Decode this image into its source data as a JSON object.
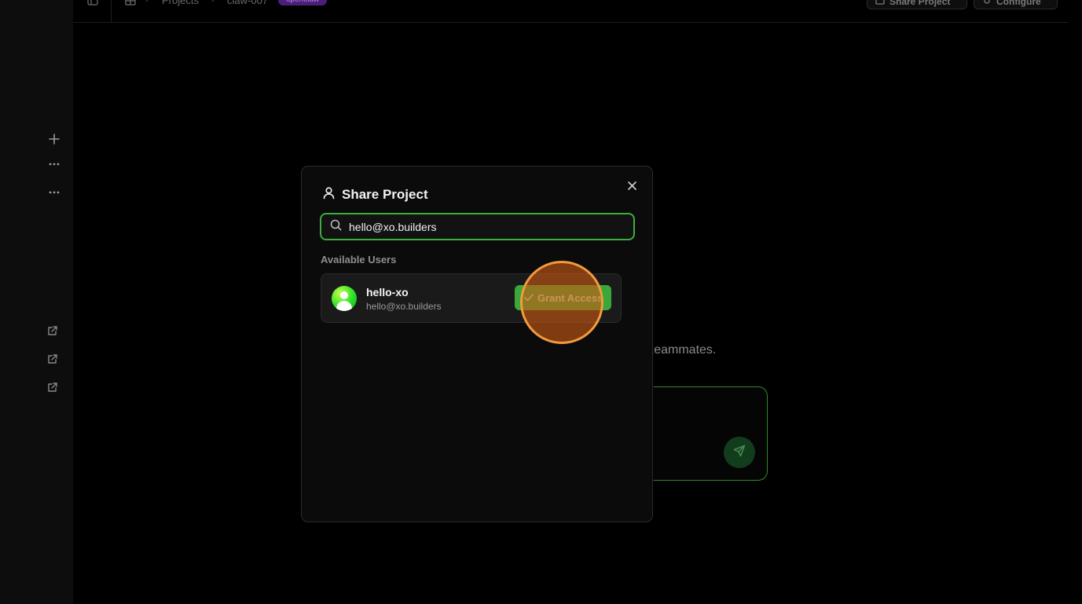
{
  "topbar": {
    "breadcrumb": [
      "Projects",
      "claw-007"
    ],
    "badge": "openclaw",
    "share_button": "Share Project",
    "configure_button": "Configure"
  },
  "background": {
    "hint_text": "r teammates."
  },
  "modal": {
    "title": "Share Project",
    "search": {
      "value": "hello@xo.builders"
    },
    "section_label": "Available Users",
    "users": [
      {
        "name": "hello-xo",
        "email": "hello@xo.builders",
        "action": "Grant Access"
      }
    ]
  },
  "colors": {
    "accent_green": "#3dae3d",
    "button_green": "#3aa73a",
    "highlight_orange": "#f39a3c",
    "badge_purple": "#4a1f7a"
  },
  "icons": {
    "rail": [
      "plus-icon",
      "more-horizontal-icon",
      "more-horizontal-icon",
      "external-link-icon",
      "external-link-icon",
      "external-link-icon"
    ],
    "modal": [
      "user-icon",
      "close-icon",
      "search-icon",
      "check-icon"
    ],
    "composer": [
      "send-icon"
    ]
  }
}
